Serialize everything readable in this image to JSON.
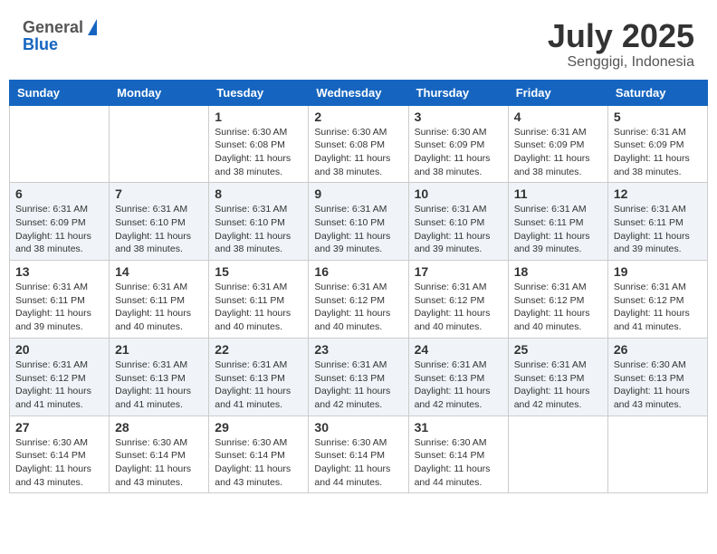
{
  "header": {
    "logo_general": "General",
    "logo_blue": "Blue",
    "month": "July 2025",
    "location": "Senggigi, Indonesia"
  },
  "days_of_week": [
    "Sunday",
    "Monday",
    "Tuesday",
    "Wednesday",
    "Thursday",
    "Friday",
    "Saturday"
  ],
  "weeks": [
    [
      {
        "day": "",
        "info": ""
      },
      {
        "day": "",
        "info": ""
      },
      {
        "day": "1",
        "info": "Sunrise: 6:30 AM\nSunset: 6:08 PM\nDaylight: 11 hours and 38 minutes."
      },
      {
        "day": "2",
        "info": "Sunrise: 6:30 AM\nSunset: 6:08 PM\nDaylight: 11 hours and 38 minutes."
      },
      {
        "day": "3",
        "info": "Sunrise: 6:30 AM\nSunset: 6:09 PM\nDaylight: 11 hours and 38 minutes."
      },
      {
        "day": "4",
        "info": "Sunrise: 6:31 AM\nSunset: 6:09 PM\nDaylight: 11 hours and 38 minutes."
      },
      {
        "day": "5",
        "info": "Sunrise: 6:31 AM\nSunset: 6:09 PM\nDaylight: 11 hours and 38 minutes."
      }
    ],
    [
      {
        "day": "6",
        "info": "Sunrise: 6:31 AM\nSunset: 6:09 PM\nDaylight: 11 hours and 38 minutes."
      },
      {
        "day": "7",
        "info": "Sunrise: 6:31 AM\nSunset: 6:10 PM\nDaylight: 11 hours and 38 minutes."
      },
      {
        "day": "8",
        "info": "Sunrise: 6:31 AM\nSunset: 6:10 PM\nDaylight: 11 hours and 38 minutes."
      },
      {
        "day": "9",
        "info": "Sunrise: 6:31 AM\nSunset: 6:10 PM\nDaylight: 11 hours and 39 minutes."
      },
      {
        "day": "10",
        "info": "Sunrise: 6:31 AM\nSunset: 6:10 PM\nDaylight: 11 hours and 39 minutes."
      },
      {
        "day": "11",
        "info": "Sunrise: 6:31 AM\nSunset: 6:11 PM\nDaylight: 11 hours and 39 minutes."
      },
      {
        "day": "12",
        "info": "Sunrise: 6:31 AM\nSunset: 6:11 PM\nDaylight: 11 hours and 39 minutes."
      }
    ],
    [
      {
        "day": "13",
        "info": "Sunrise: 6:31 AM\nSunset: 6:11 PM\nDaylight: 11 hours and 39 minutes."
      },
      {
        "day": "14",
        "info": "Sunrise: 6:31 AM\nSunset: 6:11 PM\nDaylight: 11 hours and 40 minutes."
      },
      {
        "day": "15",
        "info": "Sunrise: 6:31 AM\nSunset: 6:11 PM\nDaylight: 11 hours and 40 minutes."
      },
      {
        "day": "16",
        "info": "Sunrise: 6:31 AM\nSunset: 6:12 PM\nDaylight: 11 hours and 40 minutes."
      },
      {
        "day": "17",
        "info": "Sunrise: 6:31 AM\nSunset: 6:12 PM\nDaylight: 11 hours and 40 minutes."
      },
      {
        "day": "18",
        "info": "Sunrise: 6:31 AM\nSunset: 6:12 PM\nDaylight: 11 hours and 40 minutes."
      },
      {
        "day": "19",
        "info": "Sunrise: 6:31 AM\nSunset: 6:12 PM\nDaylight: 11 hours and 41 minutes."
      }
    ],
    [
      {
        "day": "20",
        "info": "Sunrise: 6:31 AM\nSunset: 6:12 PM\nDaylight: 11 hours and 41 minutes."
      },
      {
        "day": "21",
        "info": "Sunrise: 6:31 AM\nSunset: 6:13 PM\nDaylight: 11 hours and 41 minutes."
      },
      {
        "day": "22",
        "info": "Sunrise: 6:31 AM\nSunset: 6:13 PM\nDaylight: 11 hours and 41 minutes."
      },
      {
        "day": "23",
        "info": "Sunrise: 6:31 AM\nSunset: 6:13 PM\nDaylight: 11 hours and 42 minutes."
      },
      {
        "day": "24",
        "info": "Sunrise: 6:31 AM\nSunset: 6:13 PM\nDaylight: 11 hours and 42 minutes."
      },
      {
        "day": "25",
        "info": "Sunrise: 6:31 AM\nSunset: 6:13 PM\nDaylight: 11 hours and 42 minutes."
      },
      {
        "day": "26",
        "info": "Sunrise: 6:30 AM\nSunset: 6:13 PM\nDaylight: 11 hours and 43 minutes."
      }
    ],
    [
      {
        "day": "27",
        "info": "Sunrise: 6:30 AM\nSunset: 6:14 PM\nDaylight: 11 hours and 43 minutes."
      },
      {
        "day": "28",
        "info": "Sunrise: 6:30 AM\nSunset: 6:14 PM\nDaylight: 11 hours and 43 minutes."
      },
      {
        "day": "29",
        "info": "Sunrise: 6:30 AM\nSunset: 6:14 PM\nDaylight: 11 hours and 43 minutes."
      },
      {
        "day": "30",
        "info": "Sunrise: 6:30 AM\nSunset: 6:14 PM\nDaylight: 11 hours and 44 minutes."
      },
      {
        "day": "31",
        "info": "Sunrise: 6:30 AM\nSunset: 6:14 PM\nDaylight: 11 hours and 44 minutes."
      },
      {
        "day": "",
        "info": ""
      },
      {
        "day": "",
        "info": ""
      }
    ]
  ]
}
